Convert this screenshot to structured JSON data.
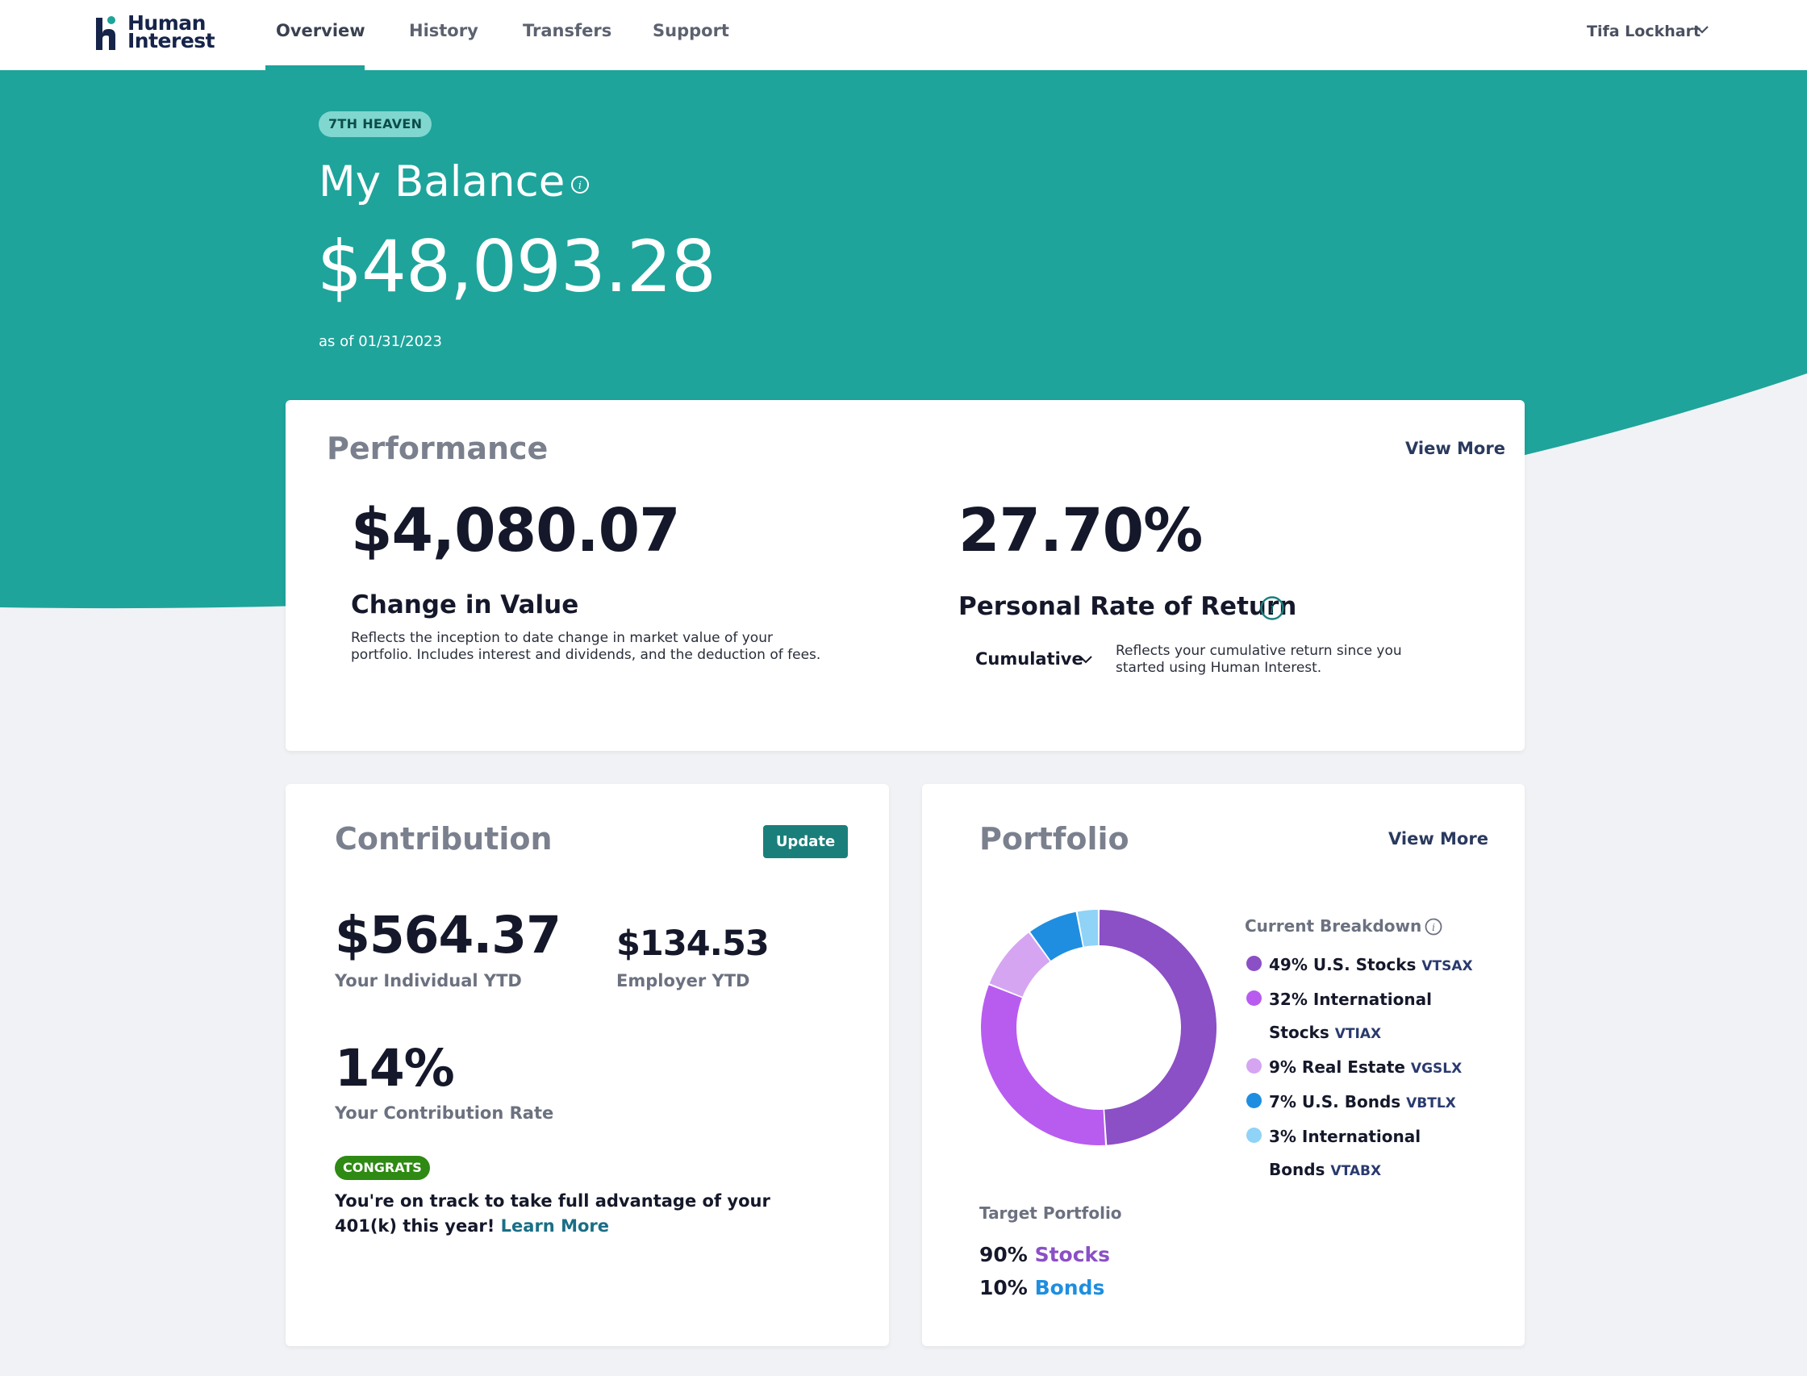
{
  "nav": {
    "logo_line1": "Human",
    "logo_line2": "Interest",
    "items": [
      {
        "label": "Overview"
      },
      {
        "label": "History"
      },
      {
        "label": "Transfers"
      },
      {
        "label": "Support"
      }
    ],
    "user_name": "Tifa Lockhart"
  },
  "hero": {
    "plan_badge": "7TH HEAVEN",
    "balance_title": "My Balance",
    "balance_amount": "$48,093.28",
    "as_of": "as of 01/31/2023"
  },
  "performance": {
    "title": "Performance",
    "view_more": "View More",
    "change_value": "$4,080.07",
    "change_label": "Change in Value",
    "change_desc_line1": "Reflects the inception to date change in market value of your",
    "change_desc_line2": "portfolio. Includes interest and dividends, and the deduction of fees.",
    "ror_value": "27.70%",
    "ror_label": "Personal Rate of Return",
    "ror_period": "Cumulative",
    "ror_desc_line1": "Reflects your cumulative return since you",
    "ror_desc_line2": "started using Human Interest."
  },
  "contribution": {
    "title": "Contribution",
    "update_button": "Update",
    "individual_ytd": "$564.37",
    "individual_label": "Your Individual YTD",
    "employer_ytd": "$134.53",
    "employer_label": "Employer YTD",
    "rate": "14%",
    "rate_label": "Your Contribution Rate",
    "congrats_badge": "CONGRATS",
    "message": "You're on track to take full advantage of your 401(k) this year!",
    "learn_more": "Learn More"
  },
  "portfolio": {
    "title": "Portfolio",
    "view_more": "View More",
    "breakdown_title": "Current Breakdown",
    "holdings": [
      {
        "text": "49% U.S. Stocks",
        "ticker": "VTSAX",
        "percent": 49,
        "color": "#8b4fc6"
      },
      {
        "text": "32% International Stocks",
        "ticker": "VTIAX",
        "percent": 32,
        "color": "#b85cf0"
      },
      {
        "text": "9% Real Estate",
        "ticker": "VGSLX",
        "percent": 9,
        "color": "#d5a5f2"
      },
      {
        "text": "7% U.S. Bonds",
        "ticker": "VBTLX",
        "percent": 7,
        "color": "#1f8ee0"
      },
      {
        "text": "3% International Bonds",
        "ticker": "VTABX",
        "percent": 3,
        "color": "#8fd3f7"
      }
    ],
    "target_title": "Target Portfolio",
    "target": [
      {
        "pct": "90%",
        "name": "Stocks",
        "color": "#8b4fc6"
      },
      {
        "pct": "10%",
        "name": "Bonds",
        "color": "#1f8ee0"
      }
    ]
  },
  "colors": {
    "brand_teal": "#1ea49b",
    "button_teal": "#1a7f7a",
    "congrats_green": "#2e8a13"
  }
}
